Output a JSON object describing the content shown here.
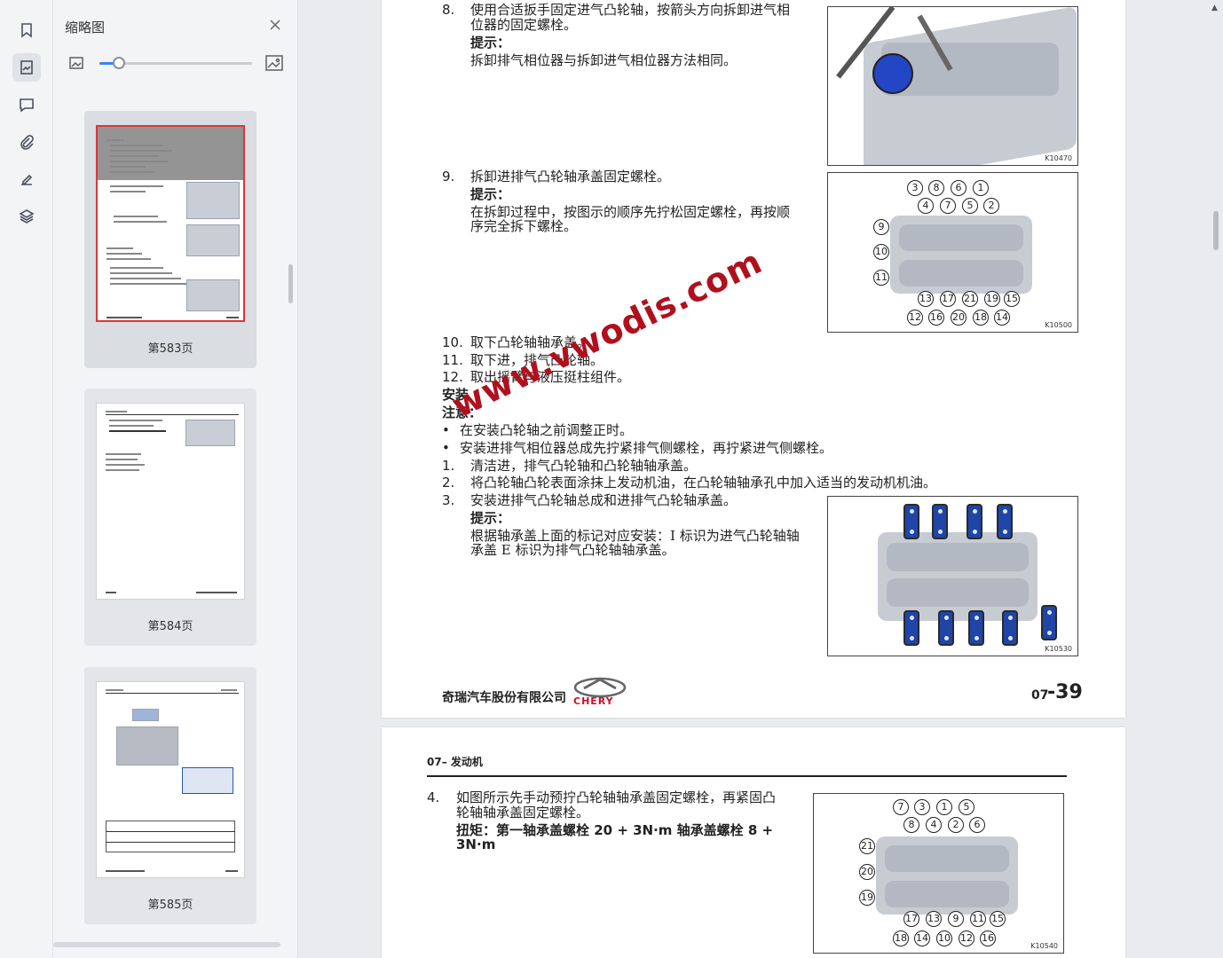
{
  "thumbnails": {
    "title": "缩略图",
    "pages": [
      {
        "label": "第583页",
        "selected": true
      },
      {
        "label": "第584页",
        "selected": false
      },
      {
        "label": "第585页",
        "selected": false
      }
    ]
  },
  "document": {
    "page39": {
      "steps": [
        {
          "num": "8.",
          "lines": [
            "使用合适扳手固定进气凸轮轴，按箭头方向拆卸进气相",
            "位器的固定螺栓。"
          ],
          "tip_label": "提示：",
          "tip": [
            "拆卸排气相位器与拆卸进气相位器方法相同。"
          ]
        },
        {
          "num": "9.",
          "lines": [
            "拆卸进排气凸轮轴承盖固定螺栓。"
          ],
          "tip_label": "提示：",
          "tip": [
            "在拆卸过程中，按图示的顺序先拧松固定螺栓，再按顺",
            "序完全拆下螺栓。"
          ]
        },
        {
          "num": "10.",
          "lines": [
            "取下凸轮轴轴承盖。"
          ]
        },
        {
          "num": "11.",
          "lines": [
            "取下进，排气凸轮轴。"
          ]
        },
        {
          "num": "12.",
          "lines": [
            "取出摇臂与液压挺柱组件。"
          ]
        }
      ],
      "install_heading": "安装",
      "caution_label": "注意：",
      "bullets": [
        "在安装凸轮轴之前调整正时。",
        "安装进排气相位器总成先拧紧排气侧螺栓，再拧紧进气侧螺栓。"
      ],
      "install_steps": [
        {
          "num": "1.",
          "text": "清洁进，排气凸轮轴和凸轮轴轴承盖。"
        },
        {
          "num": "2.",
          "text": "将凸轮轴凸轮表面涂抹上发动机油，在凸轮轴轴承孔中加入适当的发动机机油。"
        },
        {
          "num": "3.",
          "text": "安装进排气凸轮轴总成和进排气凸轮轴承盖。"
        }
      ],
      "step3_tip_label": "提示：",
      "step3_tip": [
        "根据轴承盖上面的标记对应安装：I 标识为进气凸轮轴轴",
        "承盖 E 标识为排气凸轮轴轴承盖。"
      ],
      "figures": [
        "K10470",
        "K10500",
        "K10530"
      ],
      "fig2_callouts": {
        "top1": [
          "3",
          "8",
          "6",
          "1"
        ],
        "top2": [
          "4",
          "7",
          "5",
          "2"
        ],
        "left": [
          "9",
          "10",
          "11"
        ],
        "bot1": [
          "13",
          "17",
          "21",
          "19",
          "15"
        ],
        "bot2": [
          "12",
          "16",
          "20",
          "18",
          "14"
        ]
      },
      "footer_company": "奇瑞汽车股份有限公司",
      "footer_brand": "CHERY",
      "footer_page_prefix": "07",
      "footer_page_num": "-39"
    },
    "page40": {
      "header": "07– 发动机",
      "step_num": "4.",
      "lines": [
        "如图所示先手动预拧凸轮轴轴承盖固定螺栓，再紧固凸",
        "轮轴轴承盖固定螺栓。"
      ],
      "torque": [
        "扭矩：第一轴承盖螺栓 20 + 3N·m 轴承盖螺栓 8 +",
        "3N·m"
      ],
      "figure": "K10540",
      "fig_callouts": {
        "top1": [
          "7",
          "3",
          "1",
          "5"
        ],
        "top2": [
          "8",
          "4",
          "2",
          "6"
        ],
        "left": [
          "21",
          "20",
          "19"
        ],
        "bot1": [
          "17",
          "13",
          "9",
          "11",
          "15"
        ],
        "bot2": [
          "18",
          "14",
          "10",
          "12",
          "16"
        ]
      }
    }
  },
  "watermark": "www.vwodis.com"
}
